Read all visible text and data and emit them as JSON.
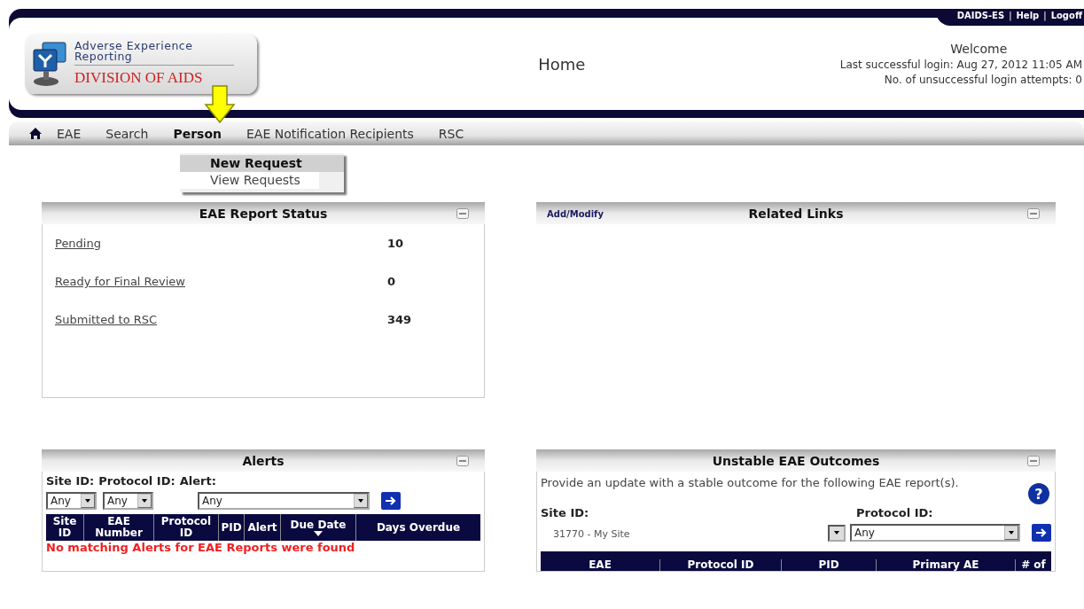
{
  "header": {
    "logo": {
      "line1": "Adverse Experience",
      "line2": "Reporting",
      "line3": "DIVISION OF AIDS"
    },
    "page_title": "Home",
    "top_links": [
      "DAIDS-ES",
      "Help",
      "Logoff"
    ],
    "link_separator": "|",
    "welcome": "Welcome",
    "last_login": "Last successful login: Aug 27, 2012 11:05 AM",
    "failed_attempts": "No. of unsuccessful login attempts: 0"
  },
  "nav": {
    "items": [
      {
        "label": "EAE",
        "selected": false
      },
      {
        "label": "Search",
        "selected": false
      },
      {
        "label": "Person",
        "selected": true
      },
      {
        "label": "EAE Notification Recipients",
        "selected": false
      },
      {
        "label": "RSC",
        "selected": false
      }
    ]
  },
  "person_menu": {
    "items": [
      {
        "label": "New Request",
        "selected": true
      },
      {
        "label": "View Requests",
        "selected": false
      }
    ]
  },
  "report_status": {
    "title": "EAE Report Status",
    "rows": [
      {
        "label": "Pending",
        "count": "10"
      },
      {
        "label": "Ready for Final Review",
        "count": "0"
      },
      {
        "label": "Submitted to RSC",
        "count": "349"
      }
    ]
  },
  "related_links": {
    "title": "Related Links",
    "action": "Add/Modify"
  },
  "alerts": {
    "title": "Alerts",
    "filter_labels": [
      "Site ID:",
      "Protocol ID:",
      "Alert:"
    ],
    "filters": [
      {
        "value": "Any",
        "kind": "short"
      },
      {
        "value": "Any",
        "kind": "short"
      },
      {
        "value": "Any",
        "kind": "long"
      }
    ],
    "columns": [
      {
        "label": "Site ID",
        "sorted": false
      },
      {
        "label": "EAE Number",
        "sorted": false
      },
      {
        "label": "Protocol ID",
        "sorted": false
      },
      {
        "label": "PID",
        "sorted": false
      },
      {
        "label": "Alert",
        "sorted": false
      },
      {
        "label": "Due Date",
        "sorted": true
      },
      {
        "label": "Days Overdue",
        "sorted": false
      }
    ],
    "empty_message": "No matching Alerts for EAE Reports were found"
  },
  "unstable": {
    "title": "Unstable EAE Outcomes",
    "description": "Provide an update with a stable outcome for the following EAE report(s).",
    "help": "?",
    "site_label": "Site ID:",
    "site_value": "31770 - My Site",
    "protocol_label": "Protocol ID:",
    "protocol_value": "Any",
    "columns": [
      "EAE",
      "Protocol ID",
      "PID",
      "Primary AE",
      "# of"
    ]
  }
}
